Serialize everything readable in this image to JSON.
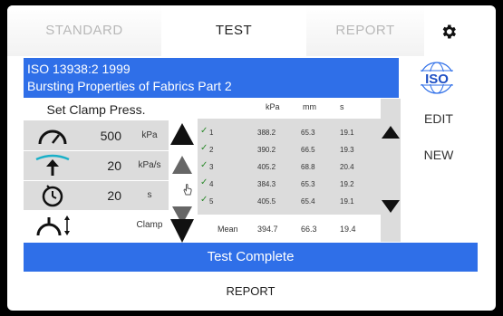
{
  "tabs": [
    {
      "label": "STANDARD"
    },
    {
      "label": "TEST"
    },
    {
      "label": "REPORT"
    }
  ],
  "icons": {
    "settings": "gear-icon",
    "logo": "iso-logo"
  },
  "header": {
    "standard": "ISO 13938:2 1999",
    "title": "Bursting Properties of Fabrics Part 2"
  },
  "side": {
    "edit": "EDIT",
    "new": "NEW"
  },
  "params": {
    "title": "Set Clamp Press.",
    "rows": [
      {
        "icon": "gauge-icon",
        "value": "500",
        "unit": "kPa"
      },
      {
        "icon": "inflation-rate-icon",
        "value": "20",
        "unit": "kPa/s"
      },
      {
        "icon": "timer-icon",
        "value": "20",
        "unit": "s"
      },
      {
        "icon": "clamp-icon",
        "value": "",
        "unit": "Clamp"
      }
    ]
  },
  "results": {
    "columns": [
      "kPa",
      "mm",
      "s"
    ],
    "rows": [
      {
        "id": "1",
        "kpa": "388.2",
        "mm": "65.3",
        "s": "19.1"
      },
      {
        "id": "2",
        "kpa": "390.2",
        "mm": "66.5",
        "s": "19.3"
      },
      {
        "id": "3",
        "kpa": "405.2",
        "mm": "68.8",
        "s": "20.4"
      },
      {
        "id": "4",
        "kpa": "384.3",
        "mm": "65.3",
        "s": "19.2"
      },
      {
        "id": "5",
        "kpa": "405.5",
        "mm": "65.4",
        "s": "19.1"
      }
    ],
    "mean": {
      "label": "Mean",
      "kpa": "394.7",
      "mm": "66.3",
      "s": "19.4"
    }
  },
  "status": {
    "complete": "Test Complete"
  },
  "footer": {
    "report": "REPORT"
  },
  "colors": {
    "accent": "#2f6fe8",
    "panel": "#dcdcdc",
    "check": "#2e8b2e"
  }
}
